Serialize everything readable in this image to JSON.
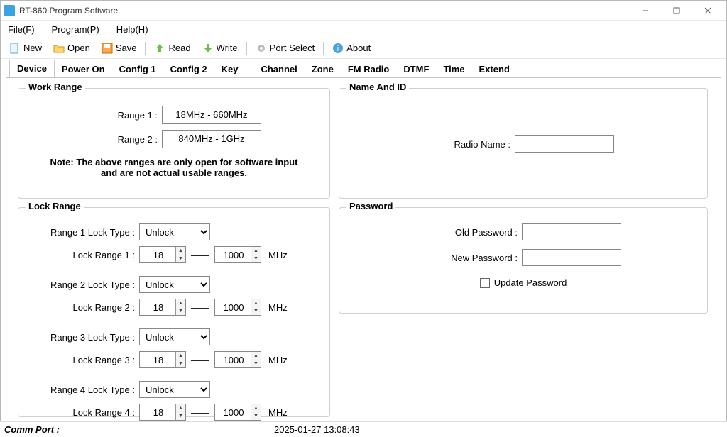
{
  "window": {
    "title": "RT-860 Program Software"
  },
  "menubar": {
    "file": "File(F)",
    "program": "Program(P)",
    "help": "Help(H)"
  },
  "toolbar": {
    "new": "New",
    "open": "Open",
    "save": "Save",
    "read": "Read",
    "write": "Write",
    "portselect": "Port Select",
    "about": "About"
  },
  "tabs": {
    "device": "Device",
    "poweron": "Power On",
    "config1": "Config 1",
    "config2": "Config 2",
    "key": "Key",
    "channel": "Channel",
    "zone": "Zone",
    "fmradio": "FM Radio",
    "dtmf": "DTMF",
    "time": "Time",
    "extend": "Extend"
  },
  "work_range": {
    "legend": "Work Range",
    "r1_label": "Range 1 :",
    "r1_value": "18MHz - 660MHz",
    "r2_label": "Range 2 :",
    "r2_value": "840MHz - 1GHz",
    "note_line1": "Note: The above ranges are only open for software input",
    "note_line2": "and are not actual usable ranges."
  },
  "lock_range": {
    "legend": "Lock Range",
    "rows": [
      {
        "type_label": "Range 1 Lock Type :",
        "type_value": "Unlock",
        "range_label": "Lock Range 1 :",
        "low": "18",
        "high": "1000",
        "unit": "MHz"
      },
      {
        "type_label": "Range 2 Lock Type :",
        "type_value": "Unlock",
        "range_label": "Lock Range 2 :",
        "low": "18",
        "high": "1000",
        "unit": "MHz"
      },
      {
        "type_label": "Range 3 Lock Type :",
        "type_value": "Unlock",
        "range_label": "Lock Range 3 :",
        "low": "18",
        "high": "1000",
        "unit": "MHz"
      },
      {
        "type_label": "Range 4 Lock Type :",
        "type_value": "Unlock",
        "range_label": "Lock Range 4 :",
        "low": "18",
        "high": "1000",
        "unit": "MHz"
      }
    ],
    "dash": "——"
  },
  "name_id": {
    "legend": "Name And ID",
    "radio_name_label": "Radio Name :",
    "radio_name_value": ""
  },
  "password": {
    "legend": "Password",
    "old_label": "Old Password :",
    "old_value": "",
    "new_label": "New Password :",
    "new_value": "",
    "update_label": "Update Password"
  },
  "statusbar": {
    "comm_port": "Comm Port :",
    "timestamp": "2025-01-27 13:08:43"
  }
}
